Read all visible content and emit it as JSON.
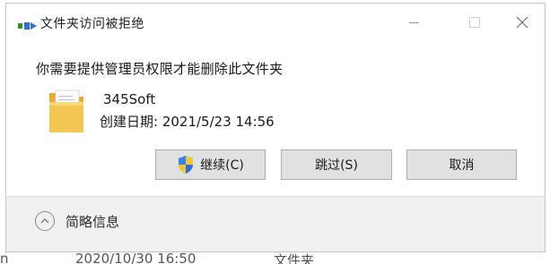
{
  "dialog": {
    "title": "文件夹访问被拒绝",
    "message": "你需要提供管理员权限才能删除此文件夹",
    "folder_name": "345Soft",
    "created_label": "创建日期: 2021/5/23 14:56",
    "buttons": {
      "continue": "继续(C)",
      "skip": "跳过(S)",
      "cancel": "取消"
    },
    "details_label": "简略信息",
    "icons": {
      "title": "folder-access-icon",
      "folder": "folder-icon",
      "shield": "uac-shield-icon",
      "details_toggle": "chevron-up-icon"
    }
  },
  "background_row": {
    "col0": "n",
    "col1": "2020/10/30 16:50",
    "col2": "文件夹"
  },
  "colors": {
    "button_bg": "#e1e1e1",
    "button_border": "#adadad",
    "footer_bg": "#f0f0f0",
    "folder_yellow": "#f1c24b"
  }
}
